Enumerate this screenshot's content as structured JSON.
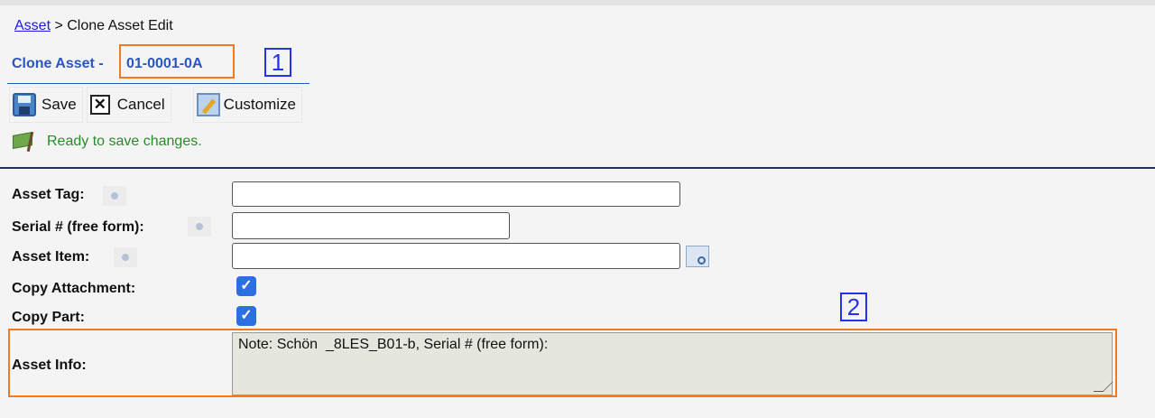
{
  "breadcrumb": {
    "root": "Asset",
    "separator": " > ",
    "current": "Clone Asset Edit"
  },
  "title": {
    "prefix": "Clone Asset - ",
    "id": "01-0001-0A"
  },
  "annotations": {
    "badge1": "1",
    "badge2": "2",
    "highlight_color": "#f07a20",
    "badge_color": "#2233ee"
  },
  "toolbar": {
    "save_label": "Save",
    "cancel_label": "Cancel",
    "customize_label": "Customize"
  },
  "status": {
    "text": "Ready to save changes."
  },
  "form": {
    "asset_tag_label": "Asset Tag:",
    "asset_tag_value": "",
    "serial_label": "Serial # (free form):",
    "serial_value": "",
    "asset_item_label": "Asset Item:",
    "asset_item_value": "",
    "copy_attachment_label": "Copy Attachment:",
    "copy_attachment_checked": true,
    "copy_part_label": "Copy Part:",
    "copy_part_checked": true,
    "asset_info_label": "Asset Info:",
    "asset_info_value": "Note: Schön  _8LES_B01-b, Serial # (free form):"
  },
  "icons": {
    "save": "save-icon",
    "cancel": "cancel-icon",
    "customize": "customize-icon",
    "status": "flag-icon",
    "help": "help-icon",
    "lookup": "lookup-icon"
  },
  "colors": {
    "title": "#2a55c4",
    "status_text": "#2a8a2a",
    "divider": "#1d2f63",
    "checkbox": "#2b6fe0"
  }
}
